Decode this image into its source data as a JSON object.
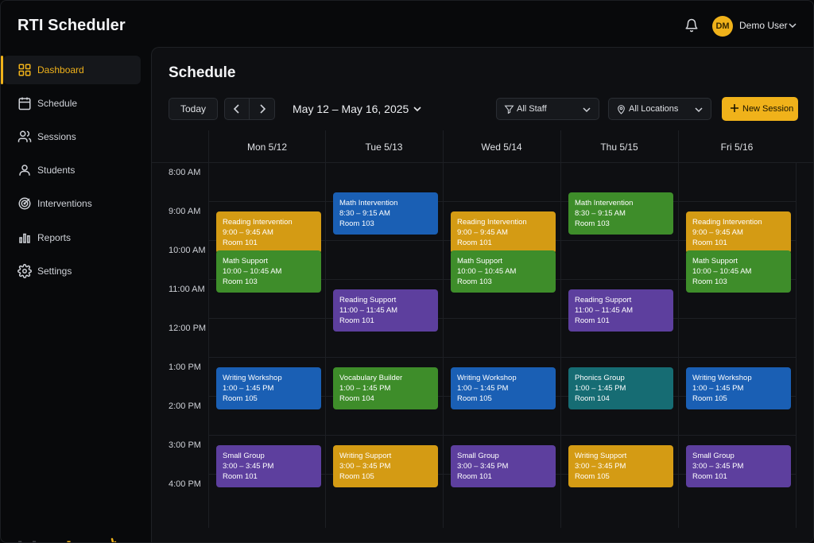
{
  "app": {
    "title": "RTI Scheduler"
  },
  "user": {
    "initials": "DM",
    "name": "Demo User"
  },
  "sidebar": {
    "items": [
      {
        "label": "Dashboard",
        "icon": "grid-icon",
        "active": true
      },
      {
        "label": "Schedule",
        "icon": "calendar-icon"
      },
      {
        "label": "Sessions",
        "icon": "users-icon"
      },
      {
        "label": "Students",
        "icon": "user-icon"
      },
      {
        "label": "Interventions",
        "icon": "target-icon"
      },
      {
        "label": "Reports",
        "icon": "bar-chart-icon"
      },
      {
        "label": "Settings",
        "icon": "gear-icon"
      }
    ]
  },
  "brand": {
    "part1": "blog",
    "part2": "bee"
  },
  "page": {
    "title": "Schedule"
  },
  "toolbar": {
    "today_label": "Today",
    "date_range": "May 12 – May 16, 2025",
    "staff_filter": "All Staff",
    "location_filter": "All Locations",
    "new_session_label": "New Session"
  },
  "calendar": {
    "days": [
      "Mon 5/12",
      "Tue 5/13",
      "Wed 5/14",
      "Thu 5/15",
      "Fri 5/16"
    ],
    "times": [
      "8:00 AM",
      "9:00 AM",
      "10:00 AM",
      "11:00 AM",
      "12:00 PM",
      "1:00 PM",
      "2:00 PM",
      "3:00 PM",
      "4:00 PM"
    ],
    "events": [
      {
        "day": 0,
        "title": "Reading Intervention",
        "time": "9:00 – 9:45 AM",
        "room": "Room 101",
        "color": "reading",
        "start": 9.0
      },
      {
        "day": 0,
        "title": "Math Support",
        "time": "10:00 – 10:45 AM",
        "room": "Room 103",
        "color": "green",
        "start": 10.0
      },
      {
        "day": 0,
        "title": "Writing Workshop",
        "time": "1:00 – 1:45 PM",
        "room": "Room 105",
        "color": "blue",
        "start": 13.0
      },
      {
        "day": 0,
        "title": "Small Group",
        "time": "3:00 – 3:45 PM",
        "room": "Room 101",
        "color": "purple",
        "start": 15.0
      },
      {
        "day": 1,
        "title": "Math Intervention",
        "time": "8:30 – 9:15 AM",
        "room": "Room 103",
        "color": "blue",
        "start": 8.5
      },
      {
        "day": 1,
        "title": "Reading Support",
        "time": "11:00 – 11:45 AM",
        "room": "Room 101",
        "color": "purple",
        "start": 11.0
      },
      {
        "day": 1,
        "title": "Vocabulary Builder",
        "time": "1:00 – 1:45 PM",
        "room": "Room 104",
        "color": "green",
        "start": 13.0
      },
      {
        "day": 1,
        "title": "Writing Support",
        "time": "3:00 – 3:45 PM",
        "room": "Room 105",
        "color": "reading",
        "start": 15.0
      },
      {
        "day": 2,
        "title": "Reading Intervention",
        "time": "9:00 – 9:45 AM",
        "room": "Room 101",
        "color": "reading",
        "start": 9.0
      },
      {
        "day": 2,
        "title": "Math Support",
        "time": "10:00 – 10:45 AM",
        "room": "Room 103",
        "color": "green",
        "start": 10.0
      },
      {
        "day": 2,
        "title": "Writing Workshop",
        "time": "1:00 – 1:45 PM",
        "room": "Room 105",
        "color": "blue",
        "start": 13.0
      },
      {
        "day": 2,
        "title": "Small Group",
        "time": "3:00 – 3:45 PM",
        "room": "Room 101",
        "color": "purple",
        "start": 15.0
      },
      {
        "day": 3,
        "title": "Math Intervention",
        "time": "8:30 – 9:15 AM",
        "room": "Room 103",
        "color": "green",
        "start": 8.5
      },
      {
        "day": 3,
        "title": "Reading Support",
        "time": "11:00 – 11:45 AM",
        "room": "Room 101",
        "color": "purple",
        "start": 11.0
      },
      {
        "day": 3,
        "title": "Phonics Group",
        "time": "1:00 – 1:45 PM",
        "room": "Room 104",
        "color": "teal",
        "start": 13.0
      },
      {
        "day": 3,
        "title": "Writing Support",
        "time": "3:00 – 3:45 PM",
        "room": "Room 105",
        "color": "reading",
        "start": 15.0
      },
      {
        "day": 4,
        "title": "Reading Intervention",
        "time": "9:00 – 9:45 AM",
        "room": "Room 101",
        "color": "reading",
        "start": 9.0
      },
      {
        "day": 4,
        "title": "Math Support",
        "time": "10:00 – 10:45 AM",
        "room": "Room 103",
        "color": "green",
        "start": 10.0
      },
      {
        "day": 4,
        "title": "Writing Workshop",
        "time": "1:00 – 1:45 PM",
        "room": "Room 105",
        "color": "blue",
        "start": 13.0
      },
      {
        "day": 4,
        "title": "Small Group",
        "time": "3:00 – 3:45 PM",
        "room": "Room 101",
        "color": "purple",
        "start": 15.0
      }
    ]
  },
  "colors": {
    "accent": "#f0b21a",
    "reading": "#d49b14",
    "green": "#3e8d2a",
    "blue": "#1a5fb4",
    "purple": "#5d3f9e",
    "teal": "#166c73"
  }
}
